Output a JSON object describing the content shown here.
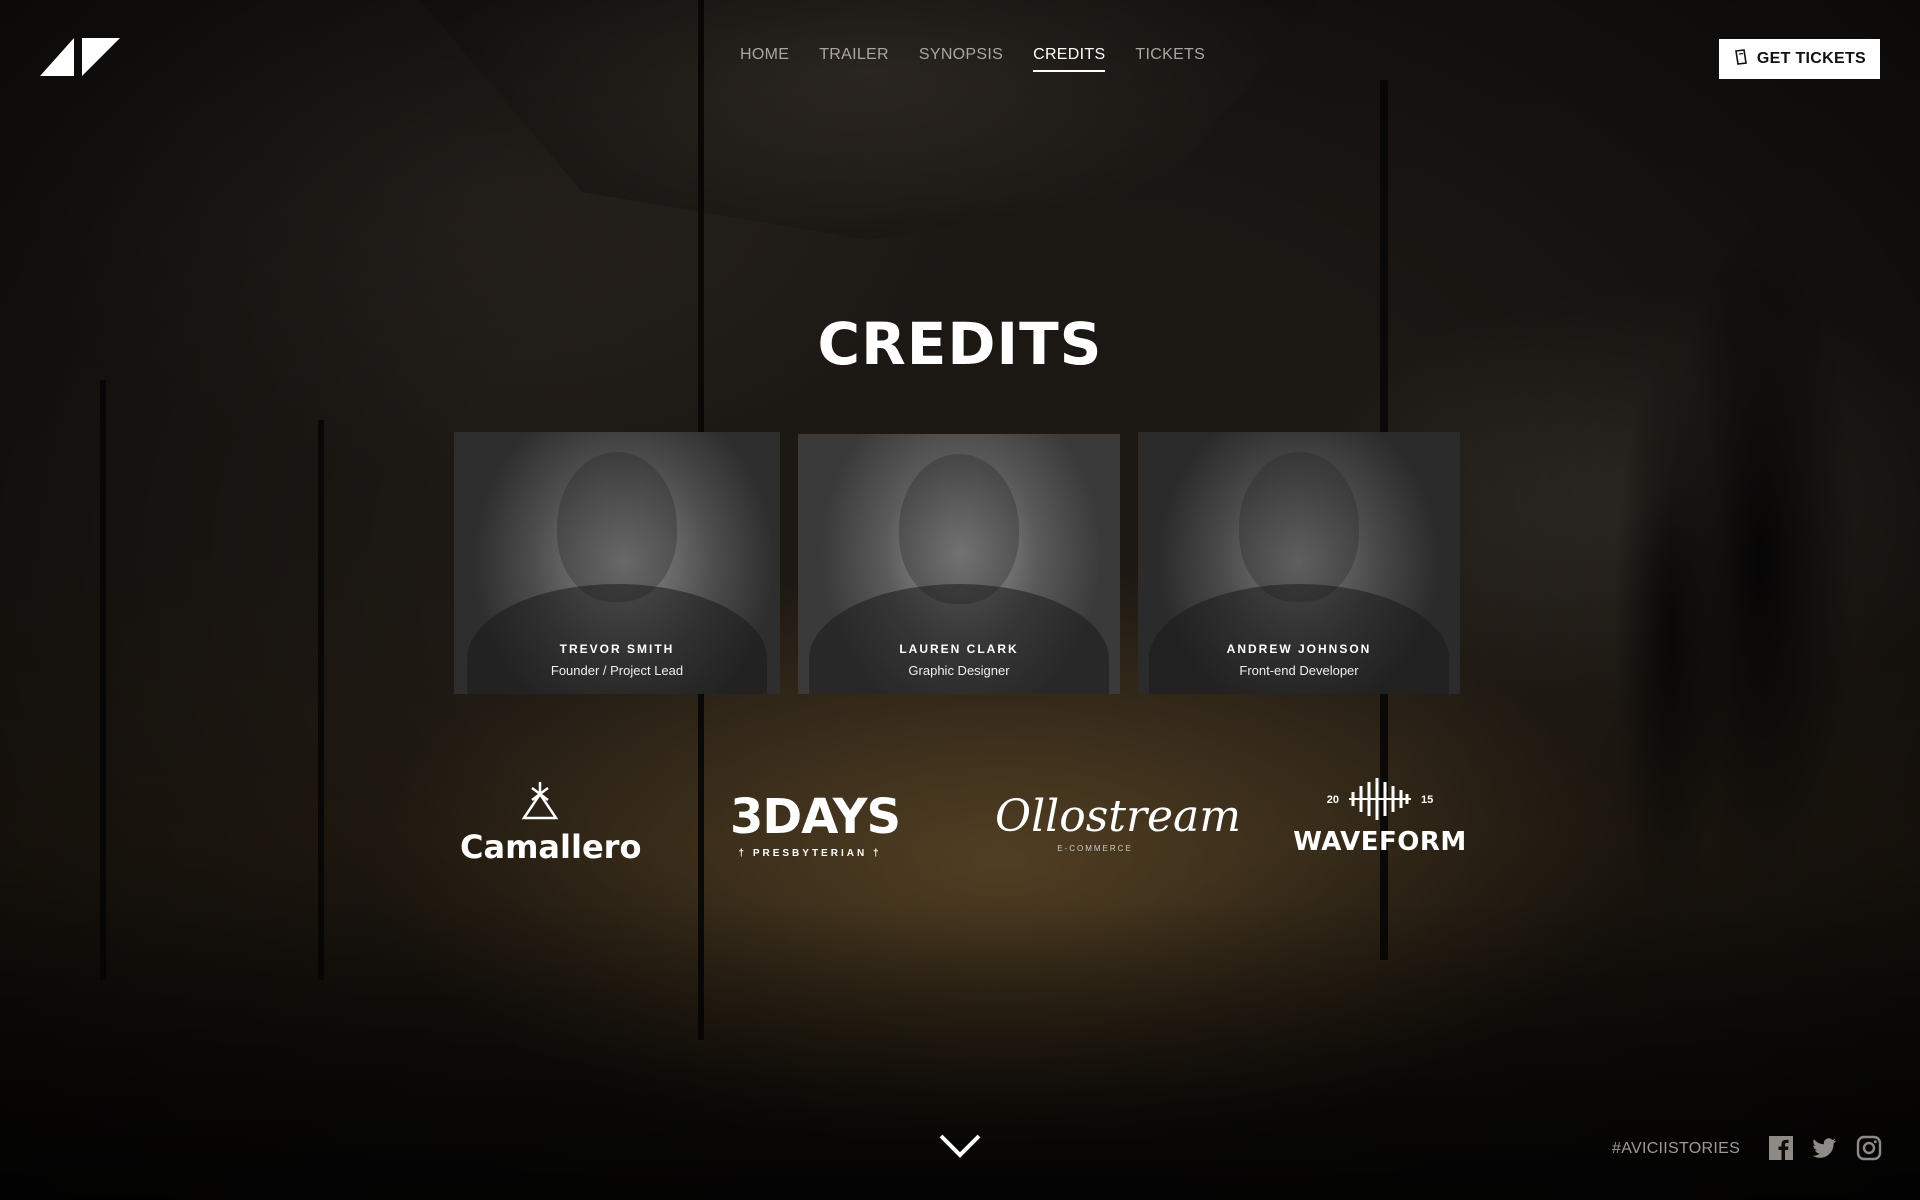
{
  "nav": {
    "items": [
      {
        "label": "HOME",
        "active": false
      },
      {
        "label": "TRAILER",
        "active": false
      },
      {
        "label": "SYNOPSIS",
        "active": false
      },
      {
        "label": "CREDITS",
        "active": true
      },
      {
        "label": "TICKETS",
        "active": false
      }
    ]
  },
  "header": {
    "logo_icon": "triangle-logo-icon",
    "tickets_button_label": "GET TICKETS",
    "tickets_icon": "ticket-icon"
  },
  "page": {
    "title": "CREDITS"
  },
  "credits": [
    {
      "name": "TREVOR SMITH",
      "role": "Founder / Project Lead"
    },
    {
      "name": "LAUREN CLARK",
      "role": "Graphic Designer"
    },
    {
      "name": "ANDREW JOHNSON",
      "role": "Front-end Developer"
    }
  ],
  "sponsors": {
    "camallero": {
      "name": "Camallero"
    },
    "threedays": {
      "name": "3DAYS",
      "subtitle": "† PRESBYTERIAN †"
    },
    "ollostream": {
      "name": "Ollostream",
      "subtitle": "E-COMMERCE"
    },
    "waveform": {
      "name": "WAVEFORM",
      "year_left": "20",
      "year_right": "15"
    }
  },
  "footer": {
    "hashtag": "#AVICIISTORIES",
    "social_icons": [
      "facebook-icon",
      "twitter-icon",
      "instagram-icon"
    ],
    "scroll_icon": "chevron-down-icon"
  },
  "colors": {
    "accent": "#ffffff",
    "nav_inactive": "#a9a6a2",
    "background": "#0d0b09"
  }
}
